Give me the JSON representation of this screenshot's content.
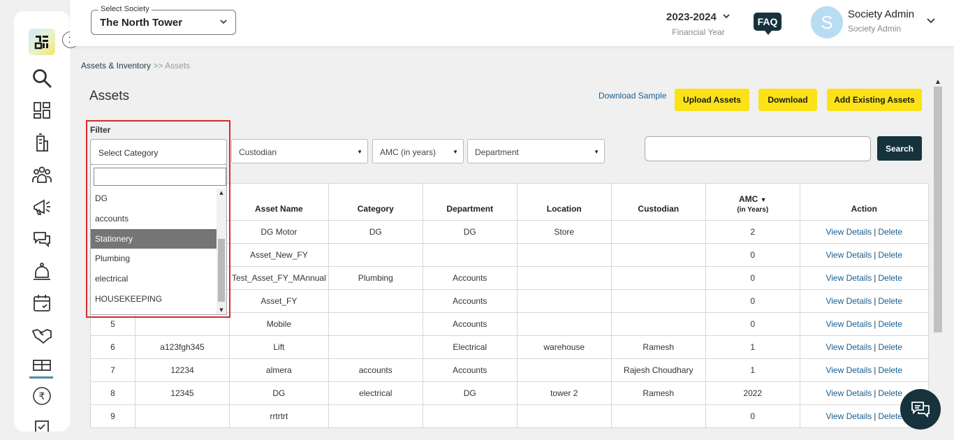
{
  "header": {
    "society_label": "Select Society",
    "society_value": "The North Tower",
    "fy_year": "2023-2024",
    "fy_label": "Financial Year",
    "faq_label": "FAQ",
    "avatar_letter": "S",
    "user_name": "Society Admin",
    "user_role": "Society Admin"
  },
  "sidebar": {
    "icons": [
      "search-icon",
      "dashboard-icon",
      "building-icon",
      "members-icon",
      "announcement-icon",
      "chat-icon",
      "services-icon",
      "calendar-icon",
      "handshake-icon",
      "assets-icon",
      "rupee-icon",
      "document-icon"
    ],
    "active": "assets-icon"
  },
  "breadcrumb": {
    "parent": "Assets & Inventory",
    "separator": ">>",
    "current": "Assets"
  },
  "page": {
    "title": "Assets",
    "download_sample": "Download Sample",
    "upload_btn": "Upload Assets",
    "download_btn": "Download",
    "add_existing_btn": "Add Existing Assets"
  },
  "filter": {
    "label": "Filter",
    "category_placeholder": "Select Category",
    "category_options": [
      "DG",
      "accounts",
      "Stationery",
      "Plumbing",
      "electrical",
      "HOUSEKEEPING"
    ],
    "category_highlighted": "Stationery",
    "custodian": "Custodian",
    "amc": "AMC (in years)",
    "department": "Department",
    "search_btn": "Search"
  },
  "table": {
    "headers": {
      "asset_name": "Asset Name",
      "category": "Category",
      "department": "Department",
      "location": "Location",
      "custodian": "Custodian",
      "amc": "AMC",
      "amc_sub": "(in Years)",
      "action": "Action"
    },
    "action_view": "View Details",
    "action_sep": "|",
    "action_delete": "Delete",
    "rows": [
      {
        "no": "",
        "code": "",
        "name": "DG Motor",
        "category": "DG",
        "department": "DG",
        "location": "Store",
        "custodian": "",
        "amc": "2"
      },
      {
        "no": "",
        "code": "",
        "name": "Asset_New_FY",
        "category": "",
        "department": "",
        "location": "",
        "custodian": "",
        "amc": "0"
      },
      {
        "no": "",
        "code": "",
        "name": "Test_Asset_FY_MAnnual",
        "category": "Plumbing",
        "department": "Accounts",
        "location": "",
        "custodian": "",
        "amc": "0"
      },
      {
        "no": "",
        "code": "",
        "name": "Asset_FY",
        "category": "",
        "department": "Accounts",
        "location": "",
        "custodian": "",
        "amc": "0"
      },
      {
        "no": "5",
        "code": "",
        "name": "Mobile",
        "category": "",
        "department": "Accounts",
        "location": "",
        "custodian": "",
        "amc": "0"
      },
      {
        "no": "6",
        "code": "a123fgh345",
        "name": "Lift",
        "category": "",
        "department": "Electrical",
        "location": "warehouse",
        "custodian": "Ramesh",
        "amc": "1"
      },
      {
        "no": "7",
        "code": "12234",
        "name": "almera",
        "category": "accounts",
        "department": "Accounts",
        "location": "",
        "custodian": "Rajesh Choudhary",
        "amc": "1"
      },
      {
        "no": "8",
        "code": "12345",
        "name": "DG",
        "category": "electrical",
        "department": "DG",
        "location": "tower 2",
        "custodian": "Ramesh",
        "amc": "2022"
      },
      {
        "no": "9",
        "code": "",
        "name": "rrtrtrt",
        "category": "",
        "department": "",
        "location": "",
        "custodian": "",
        "amc": "0"
      }
    ]
  },
  "colors": {
    "accent_yellow": "#fbe216",
    "dark_teal": "#16333d",
    "highlight_red": "#d42a2a",
    "link_blue": "#1a5d8f"
  }
}
